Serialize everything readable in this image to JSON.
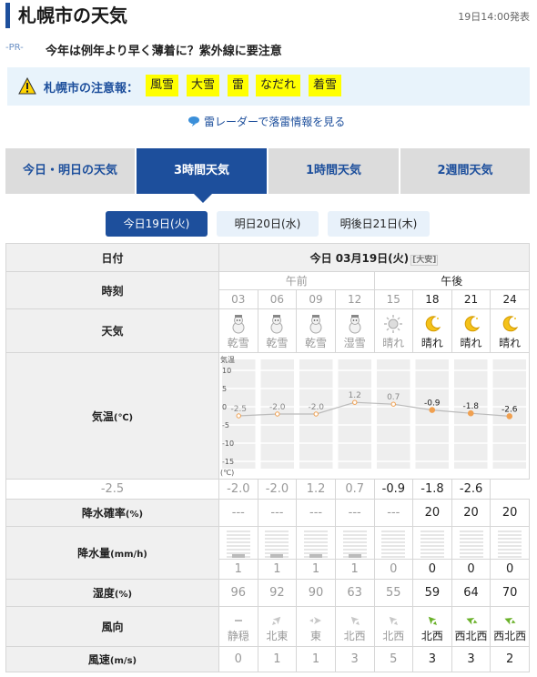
{
  "header": {
    "title": "札幌市の天気",
    "issued": "19日14:00発表"
  },
  "pr": {
    "label": "-PR-",
    "text": "今年は例年より早く薄着に？紫外線に要注意"
  },
  "warning": {
    "label": "札幌市の注意報：",
    "items": [
      "風雪",
      "大雪",
      "雷",
      "なだれ",
      "着雪"
    ]
  },
  "radar_link": "雷レーダーで落雷情報を見る",
  "tabs": [
    "今日・明日の天気",
    "3時間天気",
    "1時間天気",
    "2週間天気"
  ],
  "days": [
    "今日19日(火)",
    "明日20日(水)",
    "明後日21日(木)"
  ],
  "table": {
    "date_header": "日付",
    "date_value": "今日 03月19日(火)",
    "date_tag": "大安",
    "time_label": "時刻",
    "am": "午前",
    "pm": "午後",
    "hours": [
      "03",
      "06",
      "09",
      "12",
      "15",
      "18",
      "21",
      "24"
    ],
    "weather_label": "天気",
    "weather": [
      "乾雪",
      "乾雪",
      "乾雪",
      "湿雪",
      "晴れ",
      "晴れ",
      "晴れ",
      "晴れ"
    ],
    "weather_icons": [
      "snowman-icon",
      "snowman-icon",
      "snowman-icon",
      "snowman-wet-icon",
      "sun-icon",
      "moon-icon",
      "moon-icon",
      "moon-icon"
    ],
    "temp_label": "気温",
    "temp_unit": "(℃)",
    "temp_axis_title": "気温",
    "temp_axis_unit": "(℃)",
    "temp_ticks": [
      "10",
      "5",
      "0",
      "-5",
      "-10",
      "-15"
    ],
    "temps": [
      "-2.5",
      "-2.0",
      "-2.0",
      "1.2",
      "0.7",
      "-0.9",
      "-1.8",
      "-2.6"
    ],
    "precip_prob_label": "降水確率",
    "precip_prob_unit": "(%)",
    "precip_prob": [
      "---",
      "---",
      "---",
      "---",
      "---",
      "20",
      "20",
      "20"
    ],
    "precip_amt_label": "降水量",
    "precip_amt_unit": "(mm/h)",
    "precip_amt": [
      "1",
      "1",
      "1",
      "1",
      "0",
      "0",
      "0",
      "0"
    ],
    "humidity_label": "湿度",
    "humidity_unit": "(%)",
    "humidity": [
      "96",
      "92",
      "90",
      "63",
      "55",
      "59",
      "64",
      "70"
    ],
    "wind_dir_label": "風向",
    "wind_dir": [
      "静穏",
      "北東",
      "東",
      "北西",
      "北西",
      "北西",
      "西北西",
      "西北西"
    ],
    "wind_speed_label": "風速",
    "wind_speed_unit": "(m/s)",
    "wind_speed": [
      "0",
      "1",
      "1",
      "3",
      "5",
      "3",
      "3",
      "2"
    ]
  },
  "chart_data": {
    "type": "line",
    "categories": [
      "03",
      "06",
      "09",
      "12",
      "15",
      "18",
      "21",
      "24"
    ],
    "values": [
      -2.5,
      -2.0,
      -2.0,
      1.2,
      0.7,
      -0.9,
      -1.8,
      -2.6
    ],
    "ylabel": "気温 (℃)",
    "ylim": [
      -15,
      10
    ],
    "ticks": [
      10,
      5,
      0,
      -5,
      -10,
      -15
    ]
  },
  "colors": {
    "accent": "#1d4f9c",
    "warn": "#ffff00",
    "point": "#f0a050"
  }
}
